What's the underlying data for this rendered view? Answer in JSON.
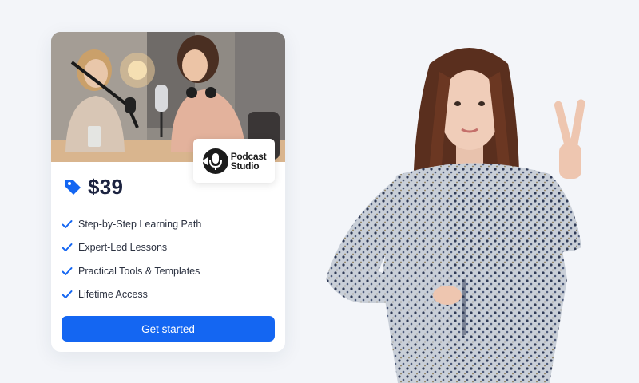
{
  "card": {
    "price": "$39",
    "logo": {
      "line1": "Podcast",
      "line2": "Studio"
    },
    "features": [
      "Step-by-Step Learning Path",
      "Expert-Led Lessons",
      "Practical Tools & Templates",
      "Lifetime Access"
    ],
    "cta_label": "Get started"
  },
  "colors": {
    "background": "#f3f5f9",
    "accent": "#1466f2",
    "price_text": "#1c2340"
  },
  "icons": {
    "price": "price-tag-icon",
    "feature": "checkmark-icon",
    "logo": "microphone-icon"
  }
}
